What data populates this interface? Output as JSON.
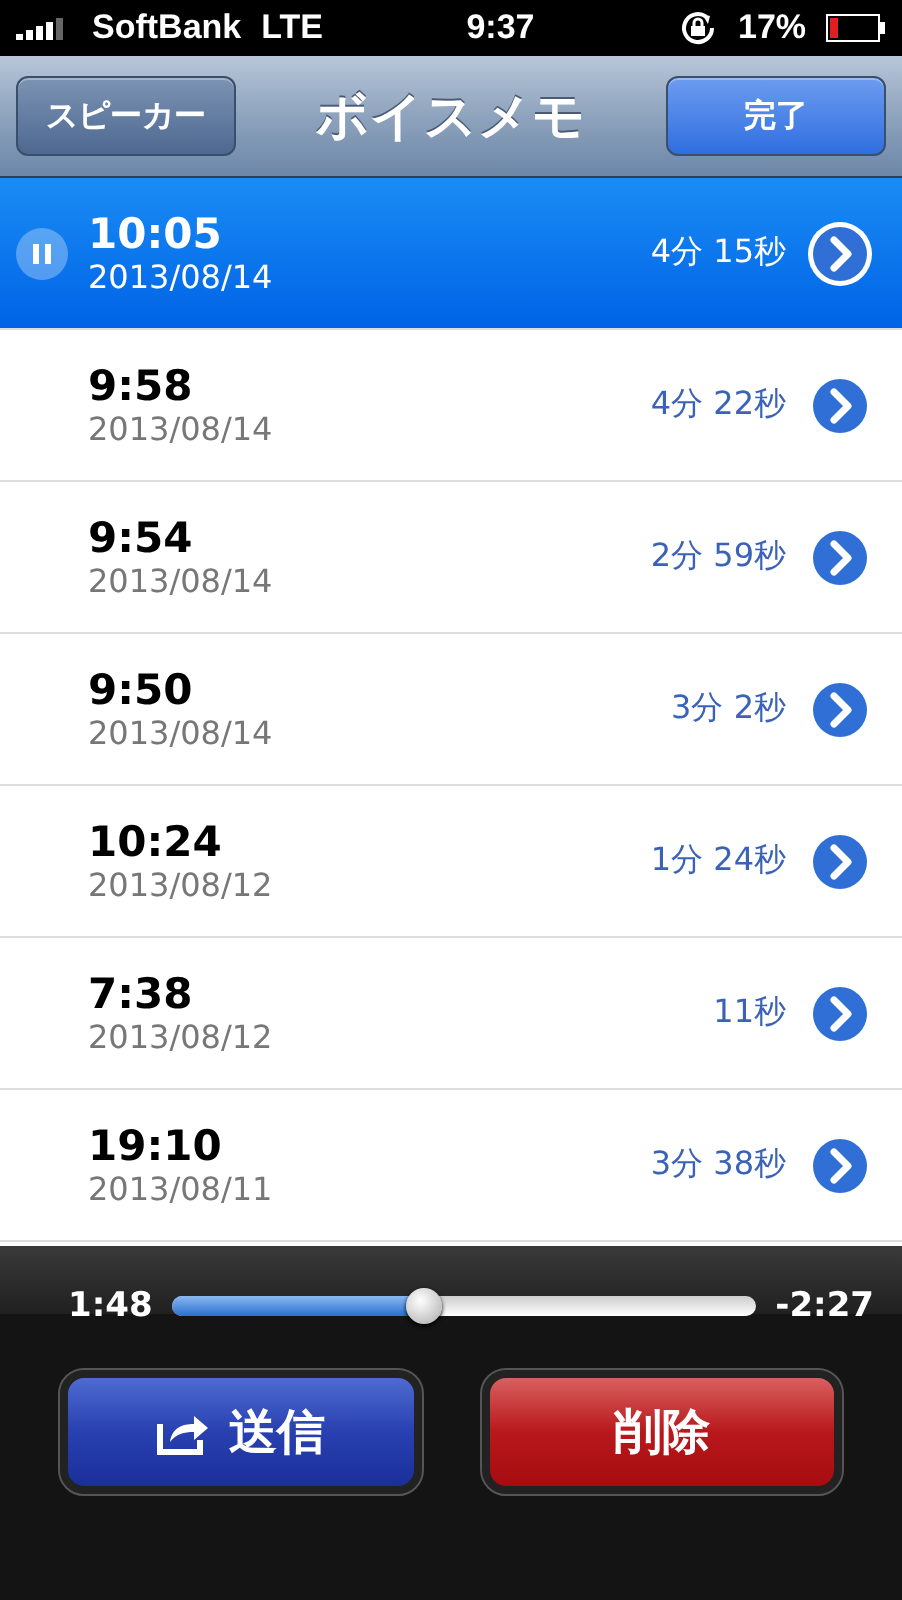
{
  "status_bar": {
    "carrier": "SoftBank",
    "network": "LTE",
    "time": "9:37",
    "battery": "17%"
  },
  "nav_bar": {
    "left_button": "スピーカー",
    "title": "ボイスメモ",
    "right_button": "完了"
  },
  "memos": [
    {
      "time": "10:05",
      "date": "2013/08/14",
      "duration": "4分 15秒",
      "selected": true
    },
    {
      "time": "9:58",
      "date": "2013/08/14",
      "duration": "4分 22秒",
      "selected": false
    },
    {
      "time": "9:54",
      "date": "2013/08/14",
      "duration": "2分 59秒",
      "selected": false
    },
    {
      "time": "9:50",
      "date": "2013/08/14",
      "duration": "3分 2秒",
      "selected": false
    },
    {
      "time": "10:24",
      "date": "2013/08/12",
      "duration": "1分 24秒",
      "selected": false
    },
    {
      "time": "7:38",
      "date": "2013/08/12",
      "duration": "11秒",
      "selected": false
    },
    {
      "time": "19:10",
      "date": "2013/08/11",
      "duration": "3分 38秒",
      "selected": false
    }
  ],
  "player": {
    "elapsed": "1:48",
    "remaining": "-2:27",
    "level": 0.43,
    "share_button": "送信",
    "delete_button": "削除"
  }
}
